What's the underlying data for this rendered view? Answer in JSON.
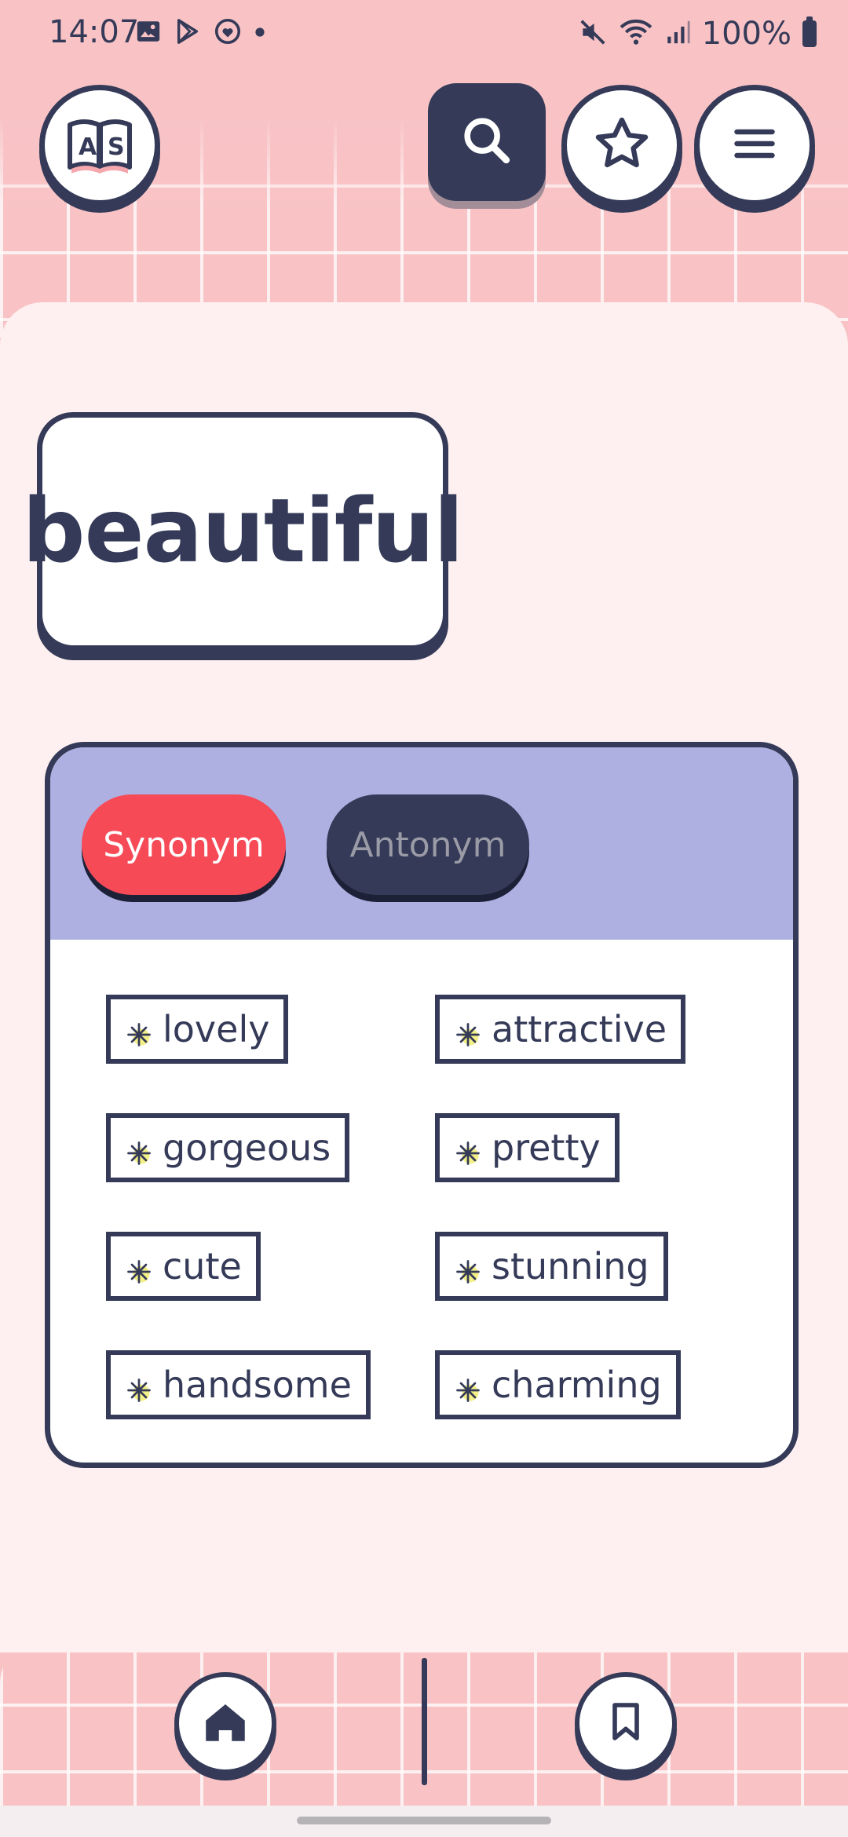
{
  "status_bar": {
    "time": "14:07",
    "battery": "100%",
    "left_icons": [
      "image-icon",
      "play-store-icon",
      "heart-badge-icon",
      "dot-icon"
    ],
    "right_icons": [
      "mute-icon",
      "wifi-icon",
      "signal-icon",
      "battery-icon"
    ]
  },
  "header": {
    "logo_icon": "book-logo-icon",
    "logo_letters": [
      "A",
      "S"
    ],
    "search_icon": "search-icon",
    "favorite_icon": "star-icon",
    "menu_icon": "menu-icon"
  },
  "word": {
    "text": "beautiful"
  },
  "tabs": [
    {
      "label": "Synonym",
      "active": true
    },
    {
      "label": "Antonym",
      "active": false
    }
  ],
  "results": [
    {
      "word": "lovely"
    },
    {
      "word": "attractive"
    },
    {
      "word": "gorgeous"
    },
    {
      "word": "pretty"
    },
    {
      "word": "cute"
    },
    {
      "word": "stunning"
    },
    {
      "word": "handsome"
    },
    {
      "word": "charming"
    }
  ],
  "bottom_nav": {
    "home_icon": "home-icon",
    "bookmark_icon": "bookmark-icon"
  },
  "colors": {
    "background_pink": "#f9c3c6",
    "content_bg": "#fef0f0",
    "navy": "#343a57",
    "synonym_red": "#f64a57",
    "panel_lavender": "#adb0e1",
    "spark_yellow": "#f4f088"
  }
}
